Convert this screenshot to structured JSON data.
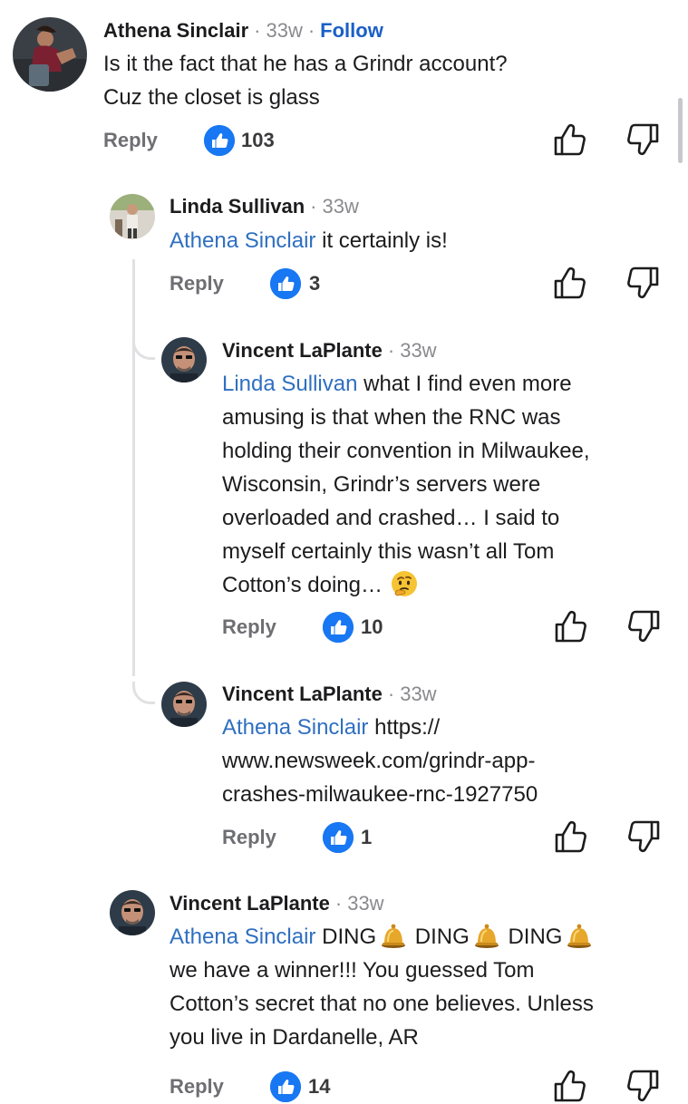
{
  "comments": [
    {
      "author": "Athena Sinclair",
      "time": "33w",
      "follow": "Follow",
      "text": "Is it the fact that he has a Grindr account?\nCuz the closet is glass",
      "reply": "Reply",
      "likes": "103"
    },
    {
      "author": "Linda Sullivan",
      "time": "33w",
      "mention": "Athena Sinclair",
      "text": " it certainly is!",
      "reply": "Reply",
      "likes": "3"
    },
    {
      "author": "Vincent LaPlante",
      "time": "33w",
      "mention": "Linda Sullivan",
      "text": " what I find even more\namusing is that when the RNC was\nholding their convention in Milwaukee,\nWisconsin, Grindr’s servers were\noverloaded and crashed… I said to\nmyself certainly this wasn’t all Tom\nCotton’s doing…",
      "emoji": "thinking-face",
      "reply": "Reply",
      "likes": "10"
    },
    {
      "author": "Vincent LaPlante",
      "time": "33w",
      "mention": "Athena Sinclair",
      "text": " https://\nwww.newsweek.com/grindr-app-\ncrashes-milwaukee-rnc-1927750",
      "reply": "Reply",
      "likes": "1"
    },
    {
      "author": "Vincent LaPlante",
      "time": "33w",
      "mention": "Athena Sinclair",
      "text_parts": [
        " DING",
        " DING",
        " DING"
      ],
      "text_rest": "we have a winner!!! You guessed Tom\nCotton’s secret that no one believes. Unless\nyou live in Dardanelle, AR",
      "emoji": "bell",
      "reply": "Reply",
      "likes": "14"
    }
  ],
  "colors": {
    "like_blue": "#1877f2",
    "mention_blue": "#2f6fc1",
    "follow_blue": "#1a5fc7",
    "muted_gray": "#8a8a8e"
  },
  "icons": [
    "thumbs-up-icon",
    "thumbs-down-icon",
    "like-reaction-icon",
    "bell-emoji",
    "thinking-face-emoji"
  ]
}
